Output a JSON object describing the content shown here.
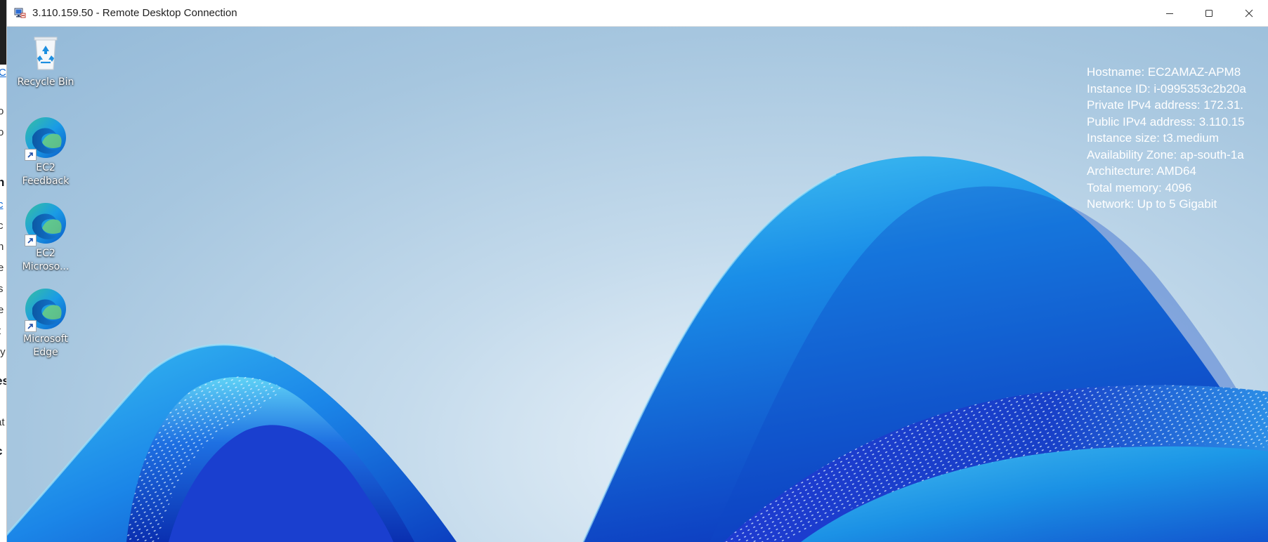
{
  "background_app": {
    "fragments": [
      "C",
      "o",
      "o",
      "n",
      "c",
      "c",
      "n",
      "e",
      "s",
      "e",
      "t",
      "ty",
      "es",
      "at",
      "c"
    ]
  },
  "window": {
    "title": "3.110.159.50 - Remote Desktop Connection",
    "icon": "remote-desktop-icon",
    "controls": {
      "minimize": "minimize-icon",
      "maximize": "maximize-icon",
      "close": "close-icon"
    }
  },
  "desktop": {
    "icons": [
      {
        "label": "Recycle Bin",
        "icon": "recycle-bin-icon"
      },
      {
        "label": "EC2 Feedback",
        "icon": "edge-icon"
      },
      {
        "label": "EC2 Microso...",
        "icon": "edge-icon"
      },
      {
        "label": "Microsoft Edge",
        "icon": "edge-icon"
      }
    ],
    "bginfo": [
      "Hostname: EC2AMAZ-APM8",
      "Instance ID: i-0995353c2b20a",
      "Private IPv4 address: 172.31.",
      "Public IPv4 address: 3.110.15",
      "Instance size: t3.medium",
      "Availability Zone: ap-south-1a",
      "Architecture: AMD64",
      "Total memory: 4096",
      "Network: Up to 5 Gigabit"
    ]
  },
  "colors": {
    "desktop_bg": "#a6c6df",
    "bloom_dark": "#1e3fc8",
    "bloom_mid": "#1e7fe6",
    "bloom_light": "#3ab8f0",
    "text_white": "#ffffff"
  }
}
